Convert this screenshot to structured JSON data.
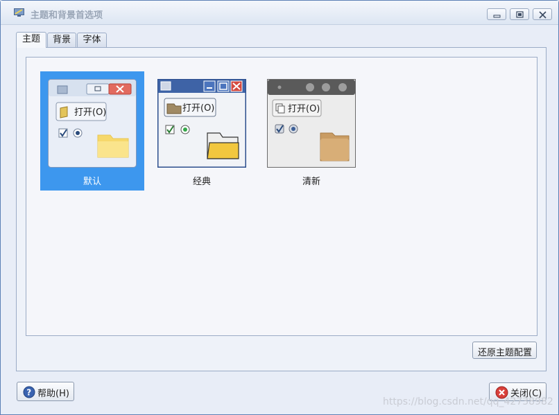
{
  "window": {
    "title": "主题和背景首选项"
  },
  "tabs": [
    {
      "label": "主题",
      "active": true
    },
    {
      "label": "背景",
      "active": false
    },
    {
      "label": "字体",
      "active": false
    }
  ],
  "themes": [
    {
      "name": "默认",
      "preview_button_label": "打开(O)",
      "selected": true
    },
    {
      "name": "经典",
      "preview_button_label": "打开(O)",
      "selected": false
    },
    {
      "name": "清新",
      "preview_button_label": "打开(O)",
      "selected": false
    }
  ],
  "buttons": {
    "restore": "还原主题配置",
    "help": "帮助(H)",
    "close": "关闭(C)"
  },
  "icons": {
    "app": "theme-preferences-icon",
    "help": "help-icon",
    "close": "close-icon",
    "minimize": "minimize-icon",
    "maximize": "maximize-icon"
  },
  "colors": {
    "selection": "#3d97ee",
    "close_button_red": "#d9403a"
  },
  "watermark": "https://blog.csdn.net/qq_42738982"
}
